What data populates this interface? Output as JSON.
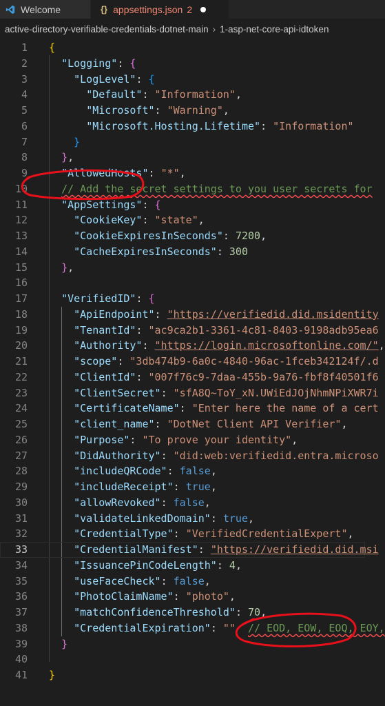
{
  "tabs": [
    {
      "label": "Welcome",
      "icon": "vscode-icon"
    },
    {
      "label": "appsettings.json",
      "icon": "json-braces-icon",
      "problem_count": "2",
      "unsaved": true
    }
  ],
  "breadcrumbs": [
    "active-directory-verifiable-credentials-dotnet-main",
    "1-asp-net-core-api-idtoken"
  ],
  "colors": {
    "accent_error": "#f14c4c",
    "annotation_red": "#e8101a"
  },
  "line_numbers": [
    "1",
    "2",
    "3",
    "4",
    "5",
    "6",
    "7",
    "8",
    "9",
    "10",
    "11",
    "12",
    "13",
    "14",
    "15",
    "16",
    "17",
    "18",
    "19",
    "20",
    "21",
    "22",
    "23",
    "24",
    "25",
    "26",
    "27",
    "28",
    "29",
    "30",
    "31",
    "32",
    "33",
    "34",
    "35",
    "36",
    "37",
    "38",
    "39",
    "40",
    "41"
  ],
  "code": {
    "l1": "{",
    "logging_key": "\"Logging\"",
    "loglevel_key": "\"LogLevel\"",
    "default_key": "\"Default\"",
    "default_val": "\"Information\"",
    "microsoft_key": "\"Microsoft\"",
    "microsoft_val": "\"Warning\"",
    "hosting_key": "\"Microsoft.Hosting.Lifetime\"",
    "hosting_val": "\"Information\"",
    "allowed_key": "\"AllowedHosts\"",
    "allowed_val": "\"*\"",
    "comment_line": "// Add the secret settings to you user secrets for",
    "appsettings_key": "\"AppSettings\"",
    "cookiekey_key": "\"CookieKey\"",
    "cookiekey_val": "\"state\"",
    "cookieexp_key": "\"CookieExpiresInSeconds\"",
    "cookieexp_val": "7200",
    "cacheexp_key": "\"CacheExpiresInSeconds\"",
    "cacheexp_val": "300",
    "verified_key": "\"VerifiedID\"",
    "apiendpoint_key": "\"ApiEndpoint\"",
    "apiendpoint_val": "\"https://verifiedid.did.msidentity",
    "tenant_key": "\"TenantId\"",
    "tenant_val": "\"ac9ca2b1-3361-4c81-8403-9198adb95ea6",
    "authority_key": "\"Authority\"",
    "authority_val": "\"https://login.microsoftonline.com/\"",
    "scope_key": "\"scope\"",
    "scope_val": "\"3db474b9-6a0c-4840-96ac-1fceb342124f/.d",
    "clientid_key": "\"ClientId\"",
    "clientid_val": "\"007f76c9-7daa-455b-9a76-fbf8f40501f6",
    "secret_key": "\"ClientSecret\"",
    "secret_val": "\"sfA8Q~ToY_xN.UWiEdJOjNhmNPiXWR7i",
    "certname_key": "\"CertificateName\"",
    "certname_val": "\"Enter here the name of a cert",
    "clientname_key": "\"client_name\"",
    "clientname_val": "\"DotNet Client API Verifier\"",
    "purpose_key": "\"Purpose\"",
    "purpose_val": "\"To prove your identity\"",
    "didauth_key": "\"DidAuthority\"",
    "didauth_val": "\"did:web:verifiedid.entra.microso",
    "qr_key": "\"includeQRCode\"",
    "qr_val": "false",
    "receipt_key": "\"includeReceipt\"",
    "receipt_val": "true",
    "revoked_key": "\"allowRevoked\"",
    "revoked_val": "false",
    "linked_key": "\"validateLinkedDomain\"",
    "linked_val": "true",
    "credtype_key": "\"CredentialType\"",
    "credtype_val": "\"VerifiedCredentialExpert\"",
    "manifest_key": "\"CredentialManifest\"",
    "manifest_val": "\"https://verifiedid.did.msi",
    "pin_key": "\"IssuancePinCodeLength\"",
    "pin_val": "4",
    "face_key": "\"useFaceCheck\"",
    "face_val": "false",
    "photo_key": "\"PhotoClaimName\"",
    "photo_val": "\"photo\"",
    "match_key": "\"matchConfidenceThreshold\"",
    "match_val": "70",
    "credexp_key": "\"CredentialExpiration\"",
    "credexp_val": "\"\"",
    "credexp_comment": "// EOD, EOW, EOQ, EOY,",
    "l41": "}"
  }
}
